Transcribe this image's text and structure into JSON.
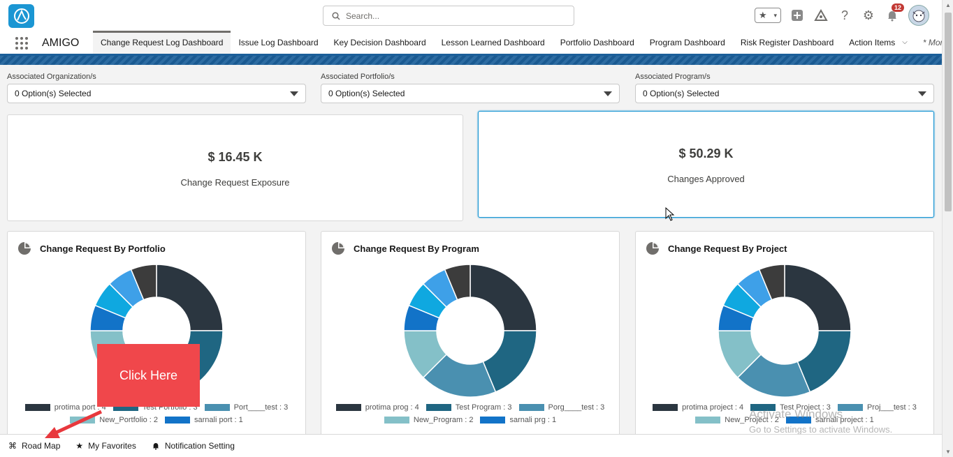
{
  "header": {
    "search_placeholder": "Search...",
    "notification_count": "12"
  },
  "nav": {
    "app_name": "AMIGO",
    "tabs": [
      {
        "label": "Change Request Log Dashboard",
        "active": true
      },
      {
        "label": "Issue Log Dashboard"
      },
      {
        "label": "Key Decision Dashboard"
      },
      {
        "label": "Lesson Learned Dashboard"
      },
      {
        "label": "Portfolio Dashboard"
      },
      {
        "label": "Program Dashboard"
      },
      {
        "label": "Risk Register Dashboard"
      },
      {
        "label": "Action Items"
      },
      {
        "label": "* More"
      }
    ]
  },
  "filters": [
    {
      "label": "Associated Organization/s",
      "value": "0 Option(s) Selected"
    },
    {
      "label": "Associated Portfolio/s",
      "value": "0 Option(s) Selected"
    },
    {
      "label": "Associated Program/s",
      "value": "0 Option(s) Selected"
    }
  ],
  "kpis": [
    {
      "value": "$ 16.45 K",
      "label": "Change Request Exposure"
    },
    {
      "value": "$ 50.29 K",
      "label": "Changes Approved"
    }
  ],
  "colors": {
    "slices": [
      "#2b3640",
      "#1f6682",
      "#4a90b0",
      "#84c0c8",
      "#1273c8",
      "#0fa8e0",
      "#3ea0e8",
      "#3c3c3c"
    ]
  },
  "chart_data": [
    {
      "type": "pie",
      "title": "Change Request By Portfolio",
      "legend_labels": [
        "protima port : 4",
        "Test Portfolio : 3",
        "Port____test : 3",
        "New_Portfolio : 2",
        "sarnali port : 1"
      ],
      "values": [
        4,
        3,
        3,
        2,
        1,
        1,
        1,
        1
      ]
    },
    {
      "type": "pie",
      "title": "Change Request By Program",
      "legend_labels": [
        "protima prog : 4",
        "Test Program : 3",
        "Porg____test : 3",
        "New_Program : 2",
        "sarnali prg : 1"
      ],
      "values": [
        4,
        3,
        3,
        2,
        1,
        1,
        1,
        1
      ]
    },
    {
      "type": "pie",
      "title": "Change Request By Project",
      "legend_labels": [
        "protima project : 4",
        "Test Project : 3",
        "Proj___test : 3",
        "New_Project : 2",
        "sarnali project : 1"
      ],
      "values": [
        4,
        3,
        3,
        2,
        1,
        1,
        1,
        1
      ]
    }
  ],
  "utility_bar": {
    "items": [
      "Road Map",
      "My Favorites",
      "Notification Setting"
    ]
  },
  "overlay": {
    "callout_text": "Click Here",
    "watermark_title": "Activate Windows",
    "watermark_sub": "Go to Settings to activate Windows."
  }
}
